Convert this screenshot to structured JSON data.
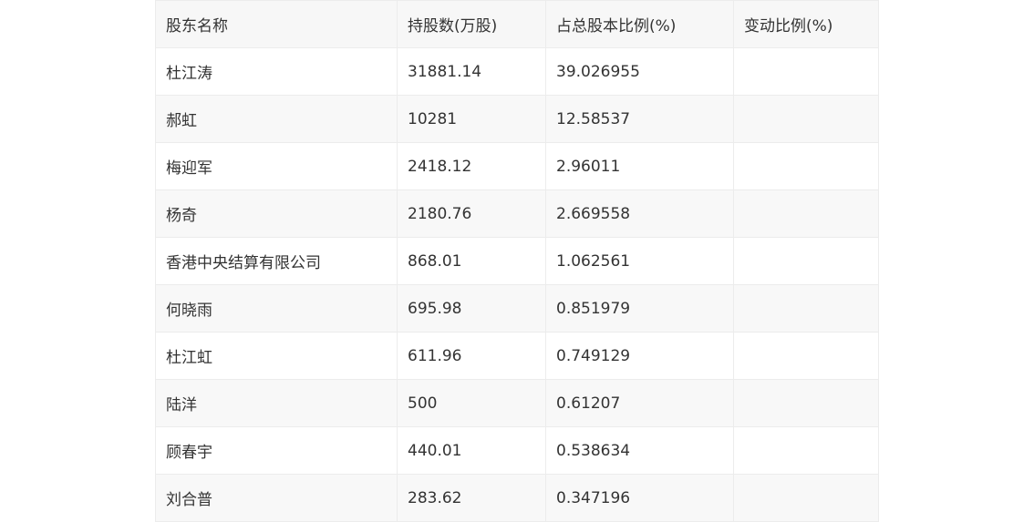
{
  "table": {
    "headers": [
      "股东名称",
      "持股数(万股)",
      "占总股本比例(%)",
      "变动比例(%)"
    ],
    "rows": [
      [
        "杜江涛",
        "31881.14",
        "39.026955",
        ""
      ],
      [
        "郝虹",
        "10281",
        "12.58537",
        ""
      ],
      [
        "梅迎军",
        "2418.12",
        "2.96011",
        ""
      ],
      [
        "杨奇",
        "2180.76",
        "2.669558",
        ""
      ],
      [
        "香港中央结算有限公司",
        "868.01",
        "1.062561",
        ""
      ],
      [
        "何晓雨",
        "695.98",
        "0.851979",
        ""
      ],
      [
        "杜江虹",
        "611.96",
        "0.749129",
        ""
      ],
      [
        "陆洋",
        "500",
        "0.61207",
        ""
      ],
      [
        "顾春宇",
        "440.01",
        "0.538634",
        ""
      ],
      [
        "刘合普",
        "283.62",
        "0.347196",
        ""
      ]
    ]
  }
}
